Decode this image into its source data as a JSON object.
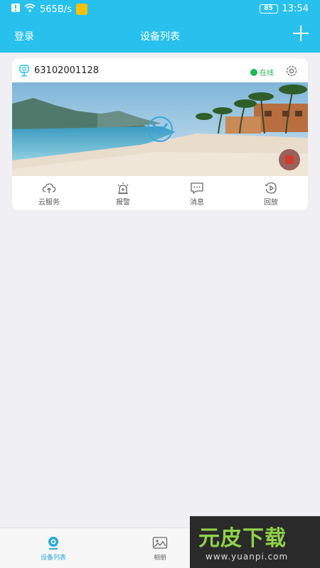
{
  "status_bar": {
    "speed": "565B/s",
    "battery": "85",
    "time": "13:54"
  },
  "header": {
    "login_label": "登录",
    "title": "设备列表"
  },
  "device": {
    "id": "63102001128",
    "status": "在线",
    "actions": [
      {
        "label": "云服务",
        "icon": "cloud-upload-icon"
      },
      {
        "label": "报警",
        "icon": "alarm-icon"
      },
      {
        "label": "消息",
        "icon": "message-icon"
      },
      {
        "label": "回放",
        "icon": "playback-icon"
      }
    ]
  },
  "bottom_nav": {
    "items": [
      {
        "label": "设备列表",
        "icon": "camera-icon",
        "active": true
      },
      {
        "label": "相册",
        "icon": "gallery-icon",
        "active": false
      }
    ]
  },
  "watermark": {
    "brand": "元皮下载",
    "url": "www.yuanpi.com"
  },
  "colors": {
    "primary": "#28c1ee",
    "online": "#1eb854",
    "active_tab": "#28a8d8"
  }
}
